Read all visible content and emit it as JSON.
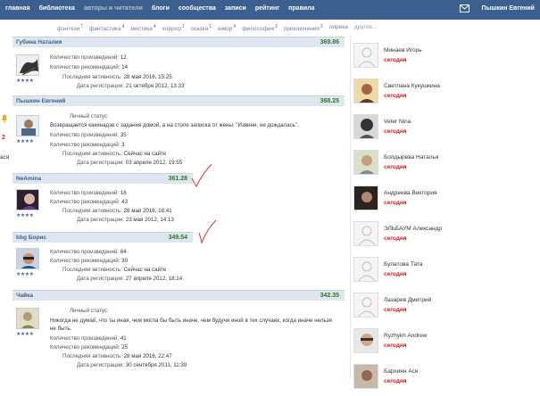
{
  "nav": {
    "items": [
      "главная",
      "библиотека",
      "авторы и читатели",
      "блоги",
      "сообщества",
      "записи",
      "рейтинг",
      "правила"
    ],
    "user": "Пышкин Евгений"
  },
  "genres": [
    {
      "name": "фэнтези",
      "count": "7"
    },
    {
      "name": "фантастика",
      "count": "4"
    },
    {
      "name": "мистика",
      "count": "4"
    },
    {
      "name": "хоррор",
      "count": "1"
    },
    {
      "name": "сказка",
      "count": "1"
    },
    {
      "name": "юмор",
      "count": "4"
    },
    {
      "name": "философия",
      "count": "2"
    },
    {
      "name": "приключения",
      "count": "3"
    },
    {
      "name": "лирика",
      "count": ""
    },
    {
      "name": "другое...",
      "count": ""
    }
  ],
  "labels": {
    "works": "Количество произведений:",
    "recs": "Количество рекомендаций:",
    "last": "Последняя активность:",
    "reg": "Дата регистрации:",
    "status": "Личный статус:"
  },
  "authors": [
    {
      "name": "Губина Наталия",
      "score": "369.86",
      "works": "12",
      "recs": "14",
      "last": "28 мая 2016, 15:25",
      "reg": "21 октября 2012, 13:33",
      "status": ""
    },
    {
      "name": "Пышкин Евгений",
      "score": "368.25",
      "works": "35",
      "recs": "3",
      "last": "Сейчас на сайте",
      "reg": "03 апреля 2012, 19:55",
      "status": "Возвращается какинадзе с задания домой, а на столе записка от жены: \"Извини, не дождалась\"."
    },
    {
      "name": "NeAmina",
      "score": "361.28",
      "works": "16",
      "recs": "43",
      "last": "28 мая 2016, 18:41",
      "reg": "23 мая 2012, 14:13",
      "status": ""
    },
    {
      "name": "bbg Борис",
      "score": "349.54",
      "works": "84",
      "recs": "30",
      "last": "Сейчас на сайте",
      "reg": "27 апреля 2012, 18:14",
      "status": ""
    },
    {
      "name": "Чайка",
      "score": "342.35",
      "works": "41",
      "recs": "25",
      "last": "28 мая 2016, 22:47",
      "reg": "30 сентября 2011, 11:39",
      "status": "Никогда не думай, что ты иная, чем могла бы быть иначе, чем будучи иной в тех случаях, когда иначе нельзя не быть."
    }
  ],
  "birthdays": [
    {
      "name": "Минаев Игорь",
      "day": "сегодня"
    },
    {
      "name": "Светлана Кукушкина",
      "day": "сегодня"
    },
    {
      "name": "Veter Nina",
      "day": "сегодня"
    },
    {
      "name": "Болдырева Наталья",
      "day": "сегодня"
    },
    {
      "name": "Андреева Виктория",
      "day": "сегодня"
    },
    {
      "name": "ЭЛЬБАУМ Александр",
      "day": "сегодня"
    },
    {
      "name": "Булатова Тата",
      "day": "сегодня"
    },
    {
      "name": "Лазарев Дмитрий",
      "day": "сегодня"
    },
    {
      "name": "Ryzhykh Andrew",
      "day": "сегодня"
    },
    {
      "name": "Бархиян Ася",
      "day": "сегодня"
    }
  ],
  "left_marks": [
    "2",
    "ася"
  ],
  "colors": {
    "topbar": "#3b5f8e",
    "score": "#2a7a2a",
    "today": "#c02020",
    "check": "#e03030"
  }
}
